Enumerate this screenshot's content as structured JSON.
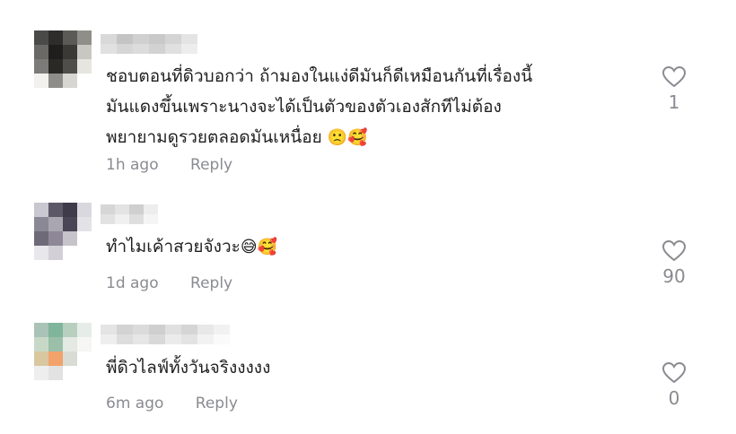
{
  "comments": [
    {
      "text_lines": [
        "ชอบตอนที่ดิวบอกว่า ถ้ามองในแง่ดีมันก็ดีเหมือนกันที่เรื่องนี้",
        "มันแดงขึ้นเพราะนางจะได้เป็นตัวของตัวเองสักทีไม่ต้อง",
        "พยายามดูรวยตลอดมันเหนื่อย"
      ],
      "emojis": "🙁🥰",
      "time": "1h ago",
      "reply_label": "Reply",
      "likes": "1"
    },
    {
      "text_lines": [
        "ทำไมเค้าสวยจังวะ"
      ],
      "emojis": "😅🥰",
      "time": "1d ago",
      "reply_label": "Reply",
      "likes": "90"
    },
    {
      "text_lines": [
        "พี่ดิวไลฟ์ทั้งวันจริงงงงง"
      ],
      "emojis": "",
      "time": "6m ago",
      "reply_label": "Reply",
      "likes": "0"
    }
  ],
  "colors": {
    "text": "#1f1f1f",
    "meta": "#8a8b91"
  },
  "icons": {
    "like": "heart-outline-icon"
  }
}
